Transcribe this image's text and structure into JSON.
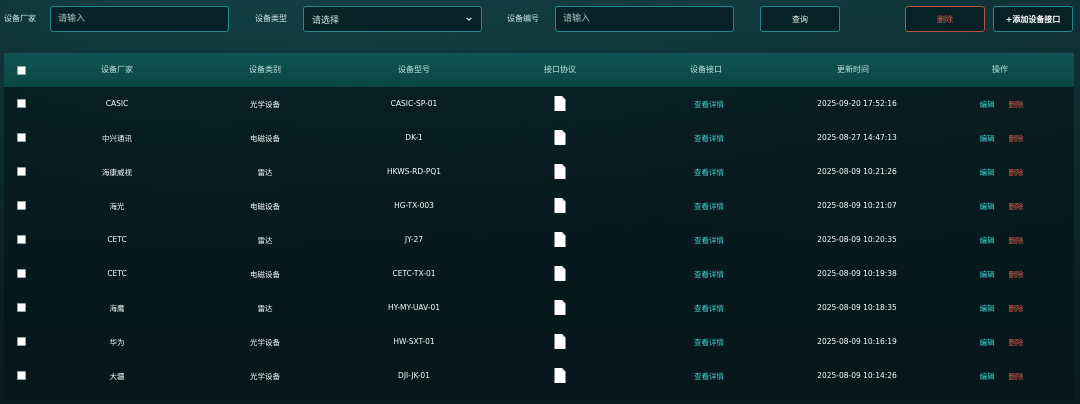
{
  "filters": {
    "manufacturer_label": "设备厂家",
    "manufacturer_placeholder": "请输入",
    "type_label": "设备类型",
    "type_value": "请选择",
    "model_label": "设备编号",
    "model_placeholder": "请输入",
    "query_label": "查询",
    "delete_label": "删除",
    "add_label": "+添加设备接口"
  },
  "table": {
    "headers": [
      "设备厂家",
      "设备类别",
      "设备型号",
      "接口协议",
      "设备接口",
      "更新时间",
      "操作"
    ],
    "detail_label": "查看详情",
    "edit_label": "编辑",
    "delete_label": "删除",
    "rows": [
      {
        "manufacturer": "CASIC",
        "category": "光学设备",
        "model": "CASIC-SP-01",
        "updated": "2025-09-20 17:52:16"
      },
      {
        "manufacturer": "中兴通讯",
        "category": "电磁设备",
        "model": "DK-1",
        "updated": "2025-08-27 14:47:13"
      },
      {
        "manufacturer": "海康威视",
        "category": "雷达",
        "model": "HKWS-RD-PQ1",
        "updated": "2025-08-09 10:21:26"
      },
      {
        "manufacturer": "海光",
        "category": "电磁设备",
        "model": "HG-TX-003",
        "updated": "2025-08-09 10:21:07"
      },
      {
        "manufacturer": "CETC",
        "category": "雷达",
        "model": "JY-27",
        "updated": "2025-08-09 10:20:35"
      },
      {
        "manufacturer": "CETC",
        "category": "电磁设备",
        "model": "CETC-TX-01",
        "updated": "2025-08-09 10:19:38"
      },
      {
        "manufacturer": "海鹰",
        "category": "雷达",
        "model": "HY-MY-UAV-01",
        "updated": "2025-08-09 10:18:35"
      },
      {
        "manufacturer": "华为",
        "category": "光学设备",
        "model": "HW-SXT-01",
        "updated": "2025-08-09 10:16:19"
      },
      {
        "manufacturer": "大疆",
        "category": "光学设备",
        "model": "DJI-JK-01",
        "updated": "2025-08-09 10:14:26"
      }
    ]
  }
}
